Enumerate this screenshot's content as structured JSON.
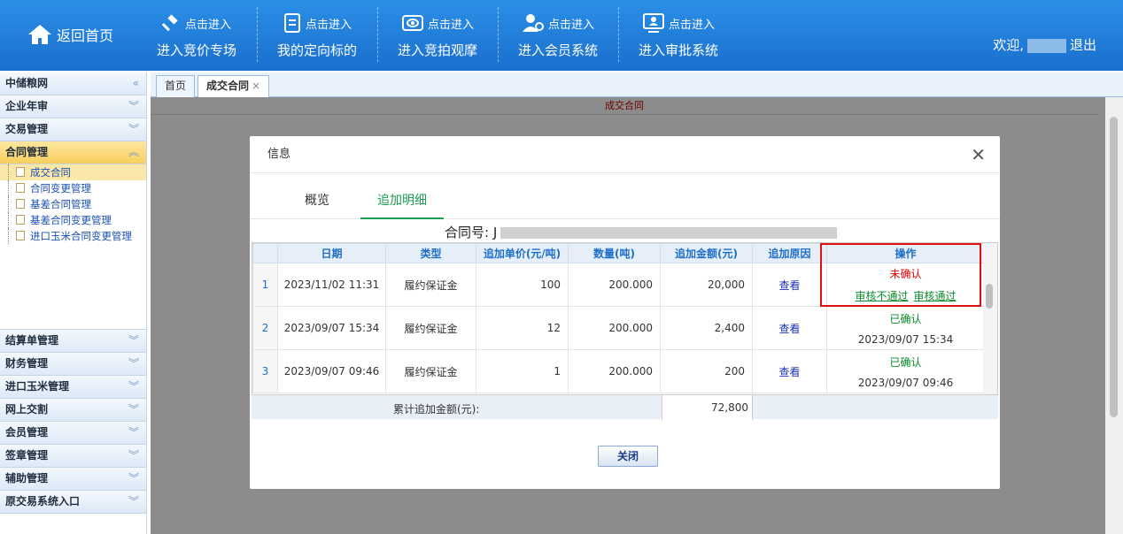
{
  "topbar": {
    "home": "返回首页",
    "nav": [
      {
        "top": "点击进入",
        "main": "进入竞价专场",
        "icon": "gavel-icon"
      },
      {
        "top": "点击进入",
        "main": "我的定向标的",
        "icon": "document-icon"
      },
      {
        "top": "点击进入",
        "main": "进入竞拍观摩",
        "icon": "eye-icon"
      },
      {
        "top": "点击进入",
        "main": "进入会员系统",
        "icon": "user-gear-icon"
      },
      {
        "top": "点击进入",
        "main": "进入审批系统",
        "icon": "monitor-user-icon"
      }
    ],
    "welcome": "欢迎,",
    "logout": "退出"
  },
  "sidebar": {
    "top": [
      "中储粮网",
      "企业年审",
      "交易管理",
      "合同管理"
    ],
    "subs": [
      "成交合同",
      "合同变更管理",
      "基差合同管理",
      "基差合同变更管理",
      "进口玉米合同变更管理"
    ],
    "bottom": [
      "结算单管理",
      "财务管理",
      "进口玉米管理",
      "网上交割",
      "会员管理",
      "签章管理",
      "辅助管理",
      "原交易系统入口"
    ]
  },
  "tabs": {
    "home": "首页",
    "active": "成交合同",
    "close": "×"
  },
  "content": {
    "title": "成交合同"
  },
  "dialog": {
    "title": "信息",
    "close": "✕",
    "tabs": [
      "概览",
      "追加明细"
    ],
    "contract_label": "合同号: J",
    "headers": [
      "日期",
      "类型",
      "追加单价(元/吨)",
      "数量(吨)",
      "追加金额(元)",
      "追加原因",
      "操作"
    ],
    "rows": [
      {
        "n": "1",
        "date": "2023/11/02 11:31",
        "type": "履约保证金",
        "price": "100",
        "qty": "200.000",
        "amt": "20,000",
        "reason": "查看",
        "status": "未确认",
        "a1": "审核不通过",
        "a2": "审核通过"
      },
      {
        "n": "2",
        "date": "2023/09/07 15:34",
        "type": "履约保证金",
        "price": "12",
        "qty": "200.000",
        "amt": "2,400",
        "reason": "查看",
        "status": "已确认",
        "time": "2023/09/07 15:34"
      },
      {
        "n": "3",
        "date": "2023/09/07 09:46",
        "type": "履约保证金",
        "price": "1",
        "qty": "200.000",
        "amt": "200",
        "reason": "查看",
        "status": "已确认",
        "time": "2023/09/07 09:46"
      }
    ],
    "total_label": "累计追加金额(元):",
    "total_value": "72,800",
    "close_btn": "关闭"
  }
}
